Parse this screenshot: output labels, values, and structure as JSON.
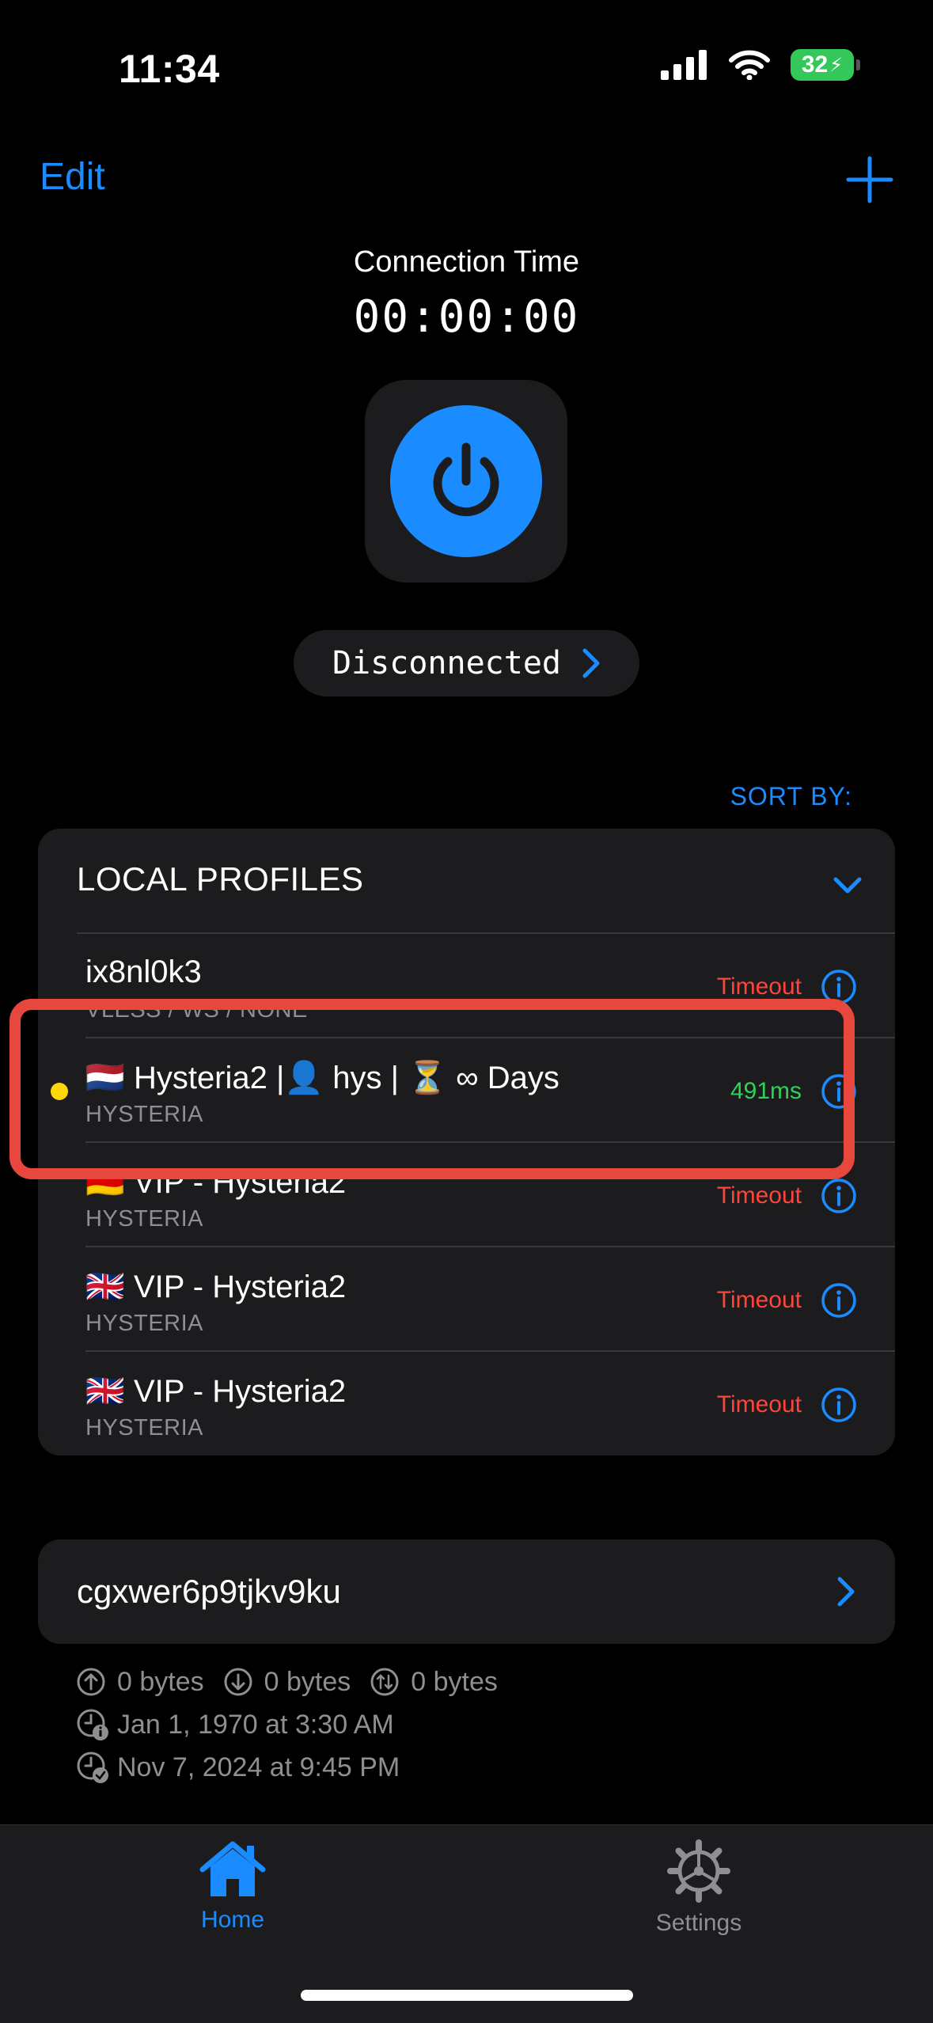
{
  "status_bar": {
    "time": "11:34",
    "battery": "32"
  },
  "nav": {
    "edit_label": "Edit"
  },
  "connection": {
    "title": "Connection Time",
    "timer": "00:00:00",
    "status": "Disconnected"
  },
  "sort_label": "SORT BY:",
  "local_profiles": {
    "header": "LOCAL PROFILES",
    "items": [
      {
        "flag": "",
        "title": "ix8nl0k3",
        "subtitle": "VLESS / WS / NONE",
        "latency": "Timeout"
      },
      {
        "flag": "🇳🇱",
        "title": "Hysteria2 |👤 hys | ⏳ ∞ Days",
        "subtitle": "HYSTERIA",
        "latency": "491ms"
      },
      {
        "flag": "🇩🇪",
        "title": "VIP - Hysteria2",
        "subtitle": "HYSTERIA",
        "latency": "Timeout"
      },
      {
        "flag": "🇬🇧",
        "title": "VIP - Hysteria2",
        "subtitle": "HYSTERIA",
        "latency": "Timeout"
      },
      {
        "flag": "🇬🇧",
        "title": "VIP - Hysteria2",
        "subtitle": "HYSTERIA",
        "latency": "Timeout"
      }
    ]
  },
  "subscription": {
    "name": "cgxwer6p9tjkv9ku",
    "upload": "0 bytes",
    "download": "0 bytes",
    "total": "0 bytes",
    "date_created": "Jan 1, 1970 at 3:30 AM",
    "date_updated": "Nov 7, 2024 at 9:45 PM"
  },
  "tabs": {
    "home": "Home",
    "settings": "Settings"
  },
  "colors": {
    "accent": "#1a8cff",
    "timeout": "#ff453a",
    "ok": "#30d158",
    "highlight": "#e8473d",
    "active_dot": "#ffd60a"
  },
  "icons": [
    "signal-icon",
    "wifi-icon",
    "battery-icon",
    "plus-icon",
    "power-icon",
    "chevron-right-icon",
    "chevron-down-icon",
    "info-icon",
    "arrow-up-icon",
    "arrow-down-icon",
    "arrows-up-down-icon",
    "clock-info-icon",
    "clock-check-icon",
    "home-icon",
    "gear-icon"
  ]
}
